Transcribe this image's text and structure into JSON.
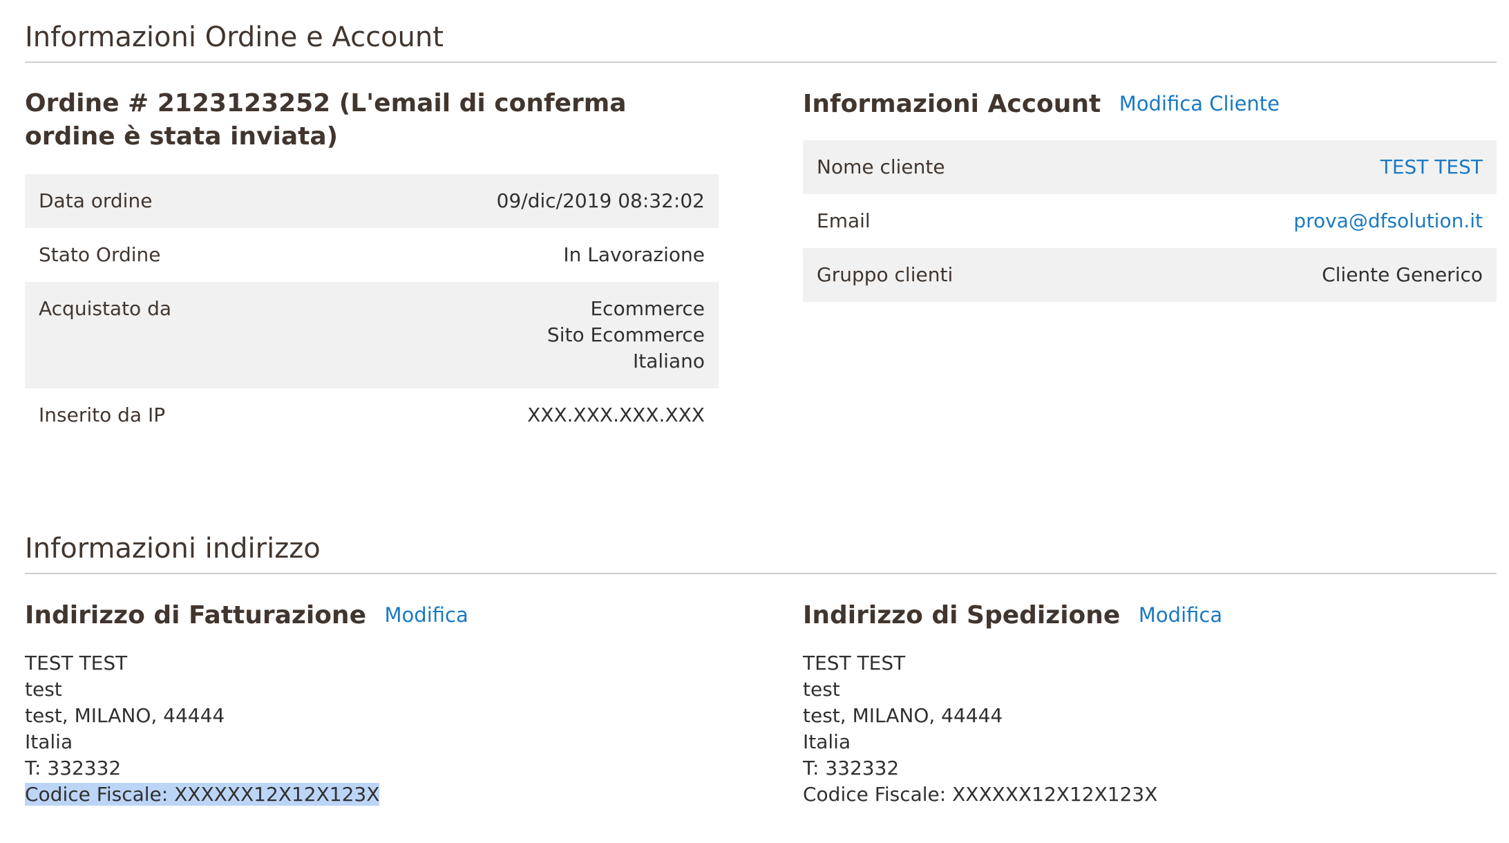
{
  "order_section": {
    "title": "Informazioni Ordine e Account"
  },
  "order": {
    "title": "Ordine # 2123123252 (L'email di conferma ordine è stata inviata)",
    "rows": [
      {
        "label": "Data ordine",
        "value": "09/dic/2019 08:32:02"
      },
      {
        "label": "Stato Ordine",
        "value": "In Lavorazione"
      },
      {
        "label": "Acquistato da",
        "lines": [
          "Ecommerce",
          "Sito Ecommerce",
          "Italiano"
        ]
      },
      {
        "label": "Inserito da IP",
        "value": "XXX.XXX.XXX.XXX"
      }
    ]
  },
  "account": {
    "title": "Informazioni Account",
    "edit_link": "Modifica Cliente",
    "rows": [
      {
        "label": "Nome cliente",
        "value": "TEST TEST"
      },
      {
        "label": "Email",
        "value": "prova@dfsolution.it"
      },
      {
        "label": "Gruppo clienti",
        "value": "Cliente Generico"
      }
    ]
  },
  "address_section": {
    "title": "Informazioni indirizzo"
  },
  "billing": {
    "title": "Indirizzo di Fatturazione",
    "edit_link": "Modifica",
    "lines": [
      "TEST TEST",
      "test",
      "test, MILANO, 44444",
      "Italia",
      "T: 332332",
      "Codice Fiscale: XXXXXX12X12X123X"
    ]
  },
  "shipping": {
    "title": "Indirizzo di Spedizione",
    "edit_link": "Modifica",
    "lines": [
      "TEST TEST",
      "test",
      "test, MILANO, 44444",
      "Italia",
      "T: 332332",
      "Codice Fiscale: XXXXXX12X12X123X"
    ]
  },
  "colors": {
    "link": "#1979c3",
    "row_background": "#f1f1f1",
    "selection_highlight": "#bcd5f7",
    "divider": "#cfcfcf"
  }
}
